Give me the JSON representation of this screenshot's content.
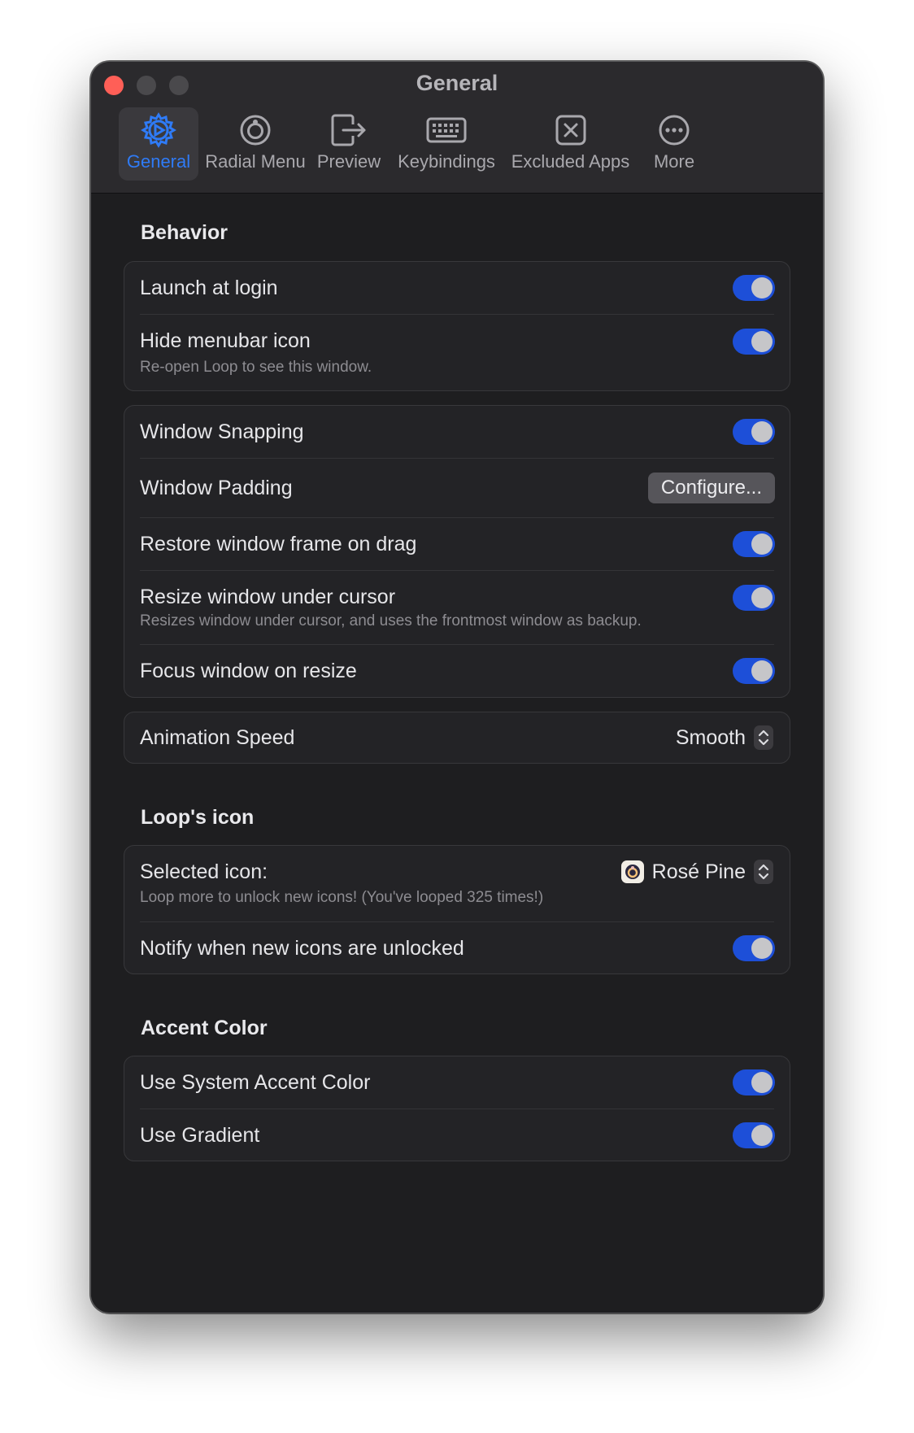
{
  "window": {
    "title": "General"
  },
  "tabs": [
    {
      "label": "General",
      "icon": "gear-play-icon"
    },
    {
      "label": "Radial Menu",
      "icon": "radial-ring-icon"
    },
    {
      "label": "Preview",
      "icon": "preview-window-arrow-icon"
    },
    {
      "label": "Keybindings",
      "icon": "keyboard-icon"
    },
    {
      "label": "Excluded Apps",
      "icon": "x-square-icon"
    },
    {
      "label": "More",
      "icon": "ellipsis-circle-icon"
    }
  ],
  "behavior": {
    "title": "Behavior",
    "launch_at_login": {
      "label": "Launch at login",
      "on": true
    },
    "hide_menubar_icon": {
      "label": "Hide menubar icon",
      "subtitle": "Re-open Loop to see this window.",
      "on": true
    },
    "window_snapping": {
      "label": "Window Snapping",
      "on": true
    },
    "window_padding": {
      "label": "Window Padding",
      "button": "Configure..."
    },
    "restore_frame": {
      "label": "Restore window frame on drag",
      "on": true
    },
    "resize_under_cursor": {
      "label": "Resize window under cursor",
      "subtitle": "Resizes window under cursor, and uses the frontmost window as backup.",
      "on": true
    },
    "focus_on_resize": {
      "label": "Focus window on resize",
      "on": true
    },
    "animation_speed": {
      "label": "Animation Speed",
      "value": "Smooth"
    }
  },
  "loops_icon": {
    "title": "Loop's icon",
    "selected_icon": {
      "label": "Selected icon:",
      "value": "Rosé Pine",
      "subtitle": "Loop more to unlock new icons! (You've looped 325 times!)"
    },
    "notify_unlocked": {
      "label": "Notify when new icons are unlocked",
      "on": true
    }
  },
  "accent_color": {
    "title": "Accent Color",
    "use_system": {
      "label": "Use System Accent Color",
      "on": true
    },
    "use_gradient": {
      "label": "Use Gradient",
      "on": true
    }
  },
  "colors": {
    "accent": "#2f7bf6",
    "toggle_on": "#1d4fd8",
    "close": "#ff5f57"
  }
}
